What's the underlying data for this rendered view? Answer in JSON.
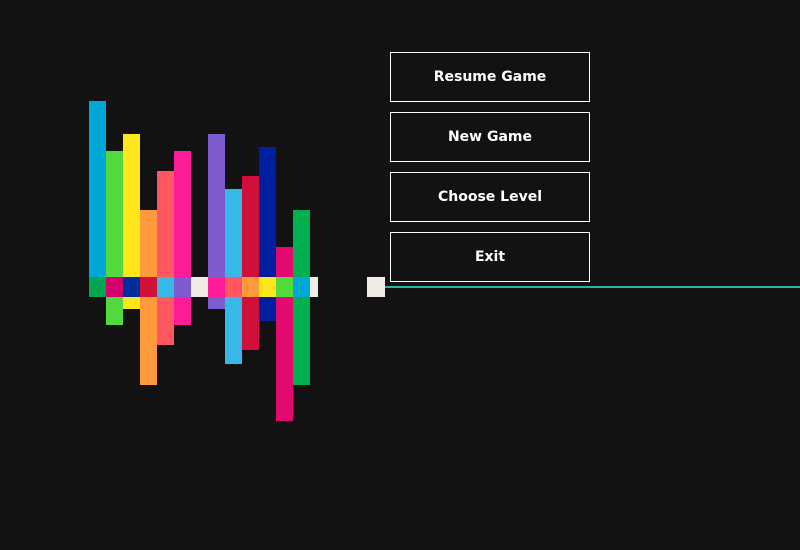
{
  "menu": {
    "items": [
      {
        "key": "resume",
        "label": "Resume Game"
      },
      {
        "key": "new",
        "label": "New Game"
      },
      {
        "key": "level",
        "label": "Choose Level"
      },
      {
        "key": "exit",
        "label": "Exit"
      }
    ]
  },
  "colors": {
    "background": "#121212",
    "button_border": "#ffffff",
    "button_text": "#ffffff",
    "player_block": "#efece6",
    "guide_line": "#2ab3a4"
  },
  "board": {
    "columns": [
      {
        "color": "#00a8d8",
        "up": 176,
        "down": 0
      },
      {
        "color": "#54d93c",
        "up": 126,
        "down": 28
      },
      {
        "color": "#ffe61a",
        "up": 143,
        "down": 12
      },
      {
        "color": "#ff9a3c",
        "up": 67,
        "down": 88
      },
      {
        "color": "#ff5762",
        "up": 106,
        "down": 48
      },
      {
        "color": "#ff1c99",
        "up": 126,
        "down": 28
      },
      {
        "color": "#121212",
        "up": 0,
        "down": 0
      },
      {
        "color": "#7e5ccf",
        "up": 143,
        "down": 12
      },
      {
        "color": "#38b8e6",
        "up": 88,
        "down": 67
      },
      {
        "color": "#d0103a",
        "up": 101,
        "down": 53
      },
      {
        "color": "#001fa0",
        "up": 130,
        "down": 24
      },
      {
        "color": "#e20a6e",
        "up": 30,
        "down": 124
      },
      {
        "color": "#00b050",
        "up": 67,
        "down": 88
      }
    ],
    "strip": [
      "#00a650",
      "#d4006e",
      "#002f9d",
      "#d01037",
      "#38b8e6",
      "#7e5ccf",
      "#efece6",
      "#ff1c99",
      "#ff5762",
      "#ff9a3c",
      "#ffe61a",
      "#54d93c",
      "#00a8d8",
      "#efece6"
    ]
  }
}
